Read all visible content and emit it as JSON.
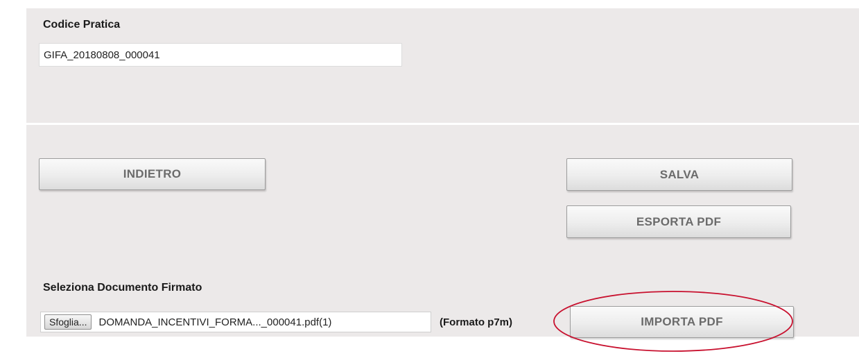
{
  "form": {
    "code_label": "Codice Pratica",
    "code_value": "GIFA_20180808_000041"
  },
  "actions": {
    "back_label": "INDIETRO",
    "save_label": "SALVA",
    "export_label": "ESPORTA PDF"
  },
  "upload": {
    "label": "Seleziona Documento Firmato",
    "browse_label": "Sfoglia...",
    "file_name": "DOMANDA_INCENTIVI_FORMA..._000041.pdf(1)",
    "format_note": "(Formato p7m)",
    "import_label": "IMPORTA PDF"
  },
  "annotation": {
    "circle_color": "#c8102e"
  }
}
